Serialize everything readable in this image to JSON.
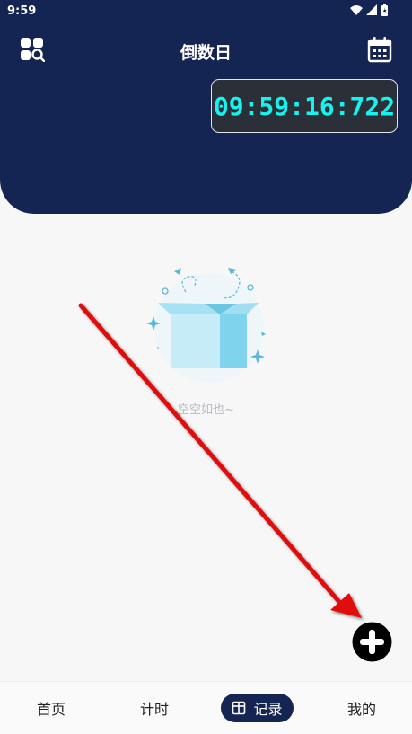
{
  "status": {
    "time": "9:59"
  },
  "header": {
    "title": "倒数日",
    "timer": "09:59:16:722"
  },
  "empty_state": {
    "text": "空空如也~"
  },
  "tabs": [
    {
      "label": "首页"
    },
    {
      "label": "计时"
    },
    {
      "label": "记录",
      "active": true
    },
    {
      "label": "我的"
    }
  ],
  "colors": {
    "header_bg": "#142453",
    "timer_text": "#18f2ef",
    "arrow": "#e01010"
  },
  "icons": [
    "grid-search-icon",
    "calendar-icon",
    "wifi-icon",
    "signal-icon",
    "battery-icon",
    "record-icon",
    "plus-icon"
  ]
}
